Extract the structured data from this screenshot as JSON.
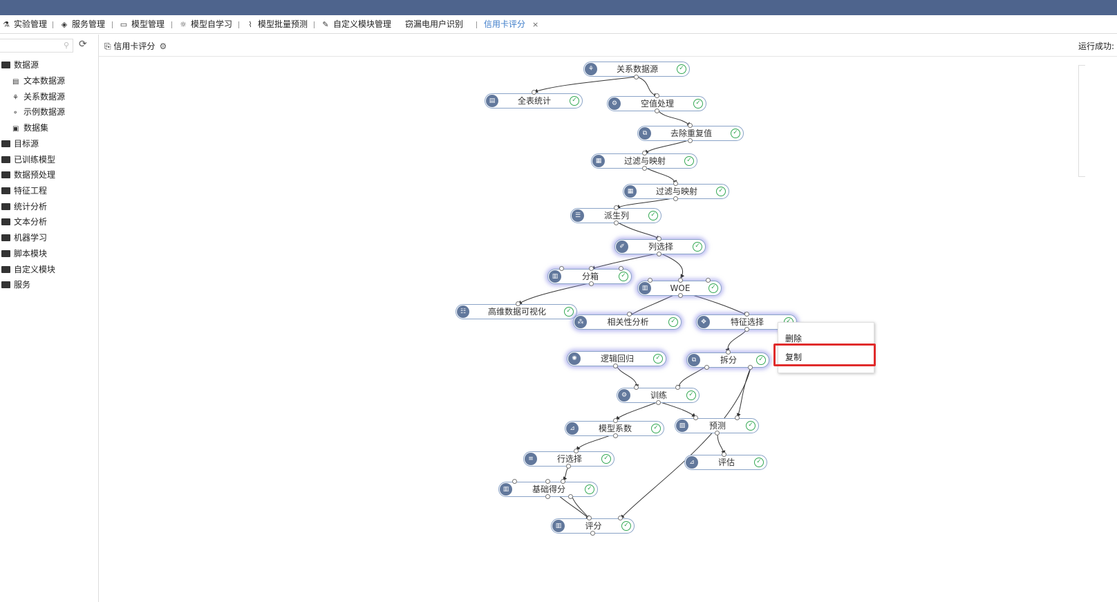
{
  "tabs": [
    {
      "label": "实验管理",
      "icon": "flask-icon"
    },
    {
      "label": "服务管理",
      "icon": "service-icon"
    },
    {
      "label": "模型管理",
      "icon": "box-icon"
    },
    {
      "label": "模型自学习",
      "icon": "bulb-icon"
    },
    {
      "label": "模型批量预测",
      "icon": "chart-icon"
    },
    {
      "label": "自定义模块管理",
      "icon": "pen-icon"
    },
    {
      "label": "窃漏电用户识别",
      "icon": ""
    },
    {
      "label": "信用卡评分",
      "icon": ""
    }
  ],
  "tab_close": "×",
  "sidebar": {
    "search_placeholder": "",
    "items": [
      {
        "label": "数据源",
        "level": 0
      },
      {
        "label": "文本数据源",
        "level": 1
      },
      {
        "label": "关系数据源",
        "level": 1
      },
      {
        "label": "示例数据源",
        "level": 1
      },
      {
        "label": "数据集",
        "level": 1
      },
      {
        "label": "目标源",
        "level": 0
      },
      {
        "label": "已训练模型",
        "level": 0
      },
      {
        "label": "数据预处理",
        "level": 0
      },
      {
        "label": "特征工程",
        "level": 0
      },
      {
        "label": "统计分析",
        "level": 0
      },
      {
        "label": "文本分析",
        "level": 0
      },
      {
        "label": "机器学习",
        "level": 0
      },
      {
        "label": "脚本模块",
        "level": 0
      },
      {
        "label": "自定义模块",
        "level": 0
      },
      {
        "label": "服务",
        "level": 0
      }
    ]
  },
  "canvas": {
    "title": "信用卡评分",
    "status": "运行成功:"
  },
  "nodes": [
    {
      "id": "n1",
      "label": "关系数据源"
    },
    {
      "id": "n2",
      "label": "全表统计"
    },
    {
      "id": "n3",
      "label": "空值处理"
    },
    {
      "id": "n4",
      "label": "去除重复值"
    },
    {
      "id": "n5",
      "label": "过滤与映射"
    },
    {
      "id": "n6",
      "label": "过滤与映射"
    },
    {
      "id": "n7",
      "label": "派生列"
    },
    {
      "id": "n8",
      "label": "列选择"
    },
    {
      "id": "n9",
      "label": "分箱"
    },
    {
      "id": "n10",
      "label": "WOE"
    },
    {
      "id": "n11",
      "label": "高维数据可视化"
    },
    {
      "id": "n12",
      "label": "相关性分析"
    },
    {
      "id": "n13",
      "label": "特征选择"
    },
    {
      "id": "n14",
      "label": "逻辑回归"
    },
    {
      "id": "n15",
      "label": "拆分"
    },
    {
      "id": "n16",
      "label": "训练"
    },
    {
      "id": "n17",
      "label": "模型系数"
    },
    {
      "id": "n18",
      "label": "预测"
    },
    {
      "id": "n19",
      "label": "行选择"
    },
    {
      "id": "n20",
      "label": "评估"
    },
    {
      "id": "n21",
      "label": "基础得分"
    },
    {
      "id": "n22",
      "label": "评分"
    }
  ],
  "context_menu": {
    "items": [
      "删除",
      "复制"
    ]
  },
  "colors": {
    "topbar": "#4e648d",
    "node_border": "#8aa3c7",
    "check": "#34a853",
    "highlight": "#e02b2b"
  }
}
